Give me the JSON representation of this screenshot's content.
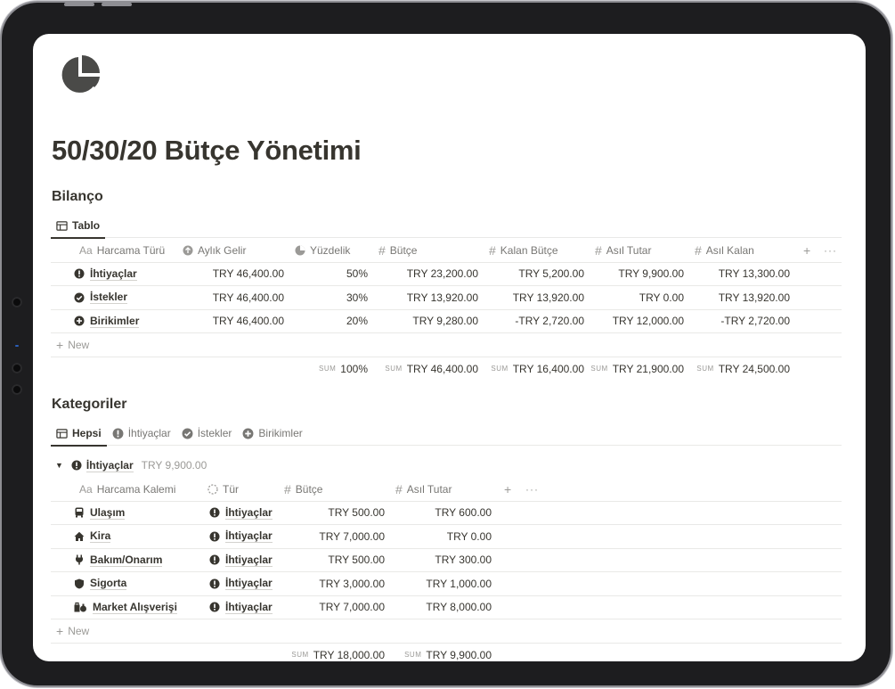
{
  "page": {
    "title": "50/30/20 Bütçe Yönetimi"
  },
  "bilanco": {
    "heading": "Bilanço",
    "view_tab": "Tablo",
    "columns": [
      "Harcama Türü",
      "Aylık Gelir",
      "Yüzdelik",
      "Bütçe",
      "Kalan Bütçe",
      "Asıl Tutar",
      "Asıl Kalan"
    ],
    "rows": [
      {
        "name": "İhtiyaçlar",
        "gelir": "TRY 46,400.00",
        "yuzde": "50%",
        "butce": "TRY 23,200.00",
        "kalan": "TRY 5,200.00",
        "asil": "TRY 9,900.00",
        "asil_kalan": "TRY 13,300.00"
      },
      {
        "name": "İstekler",
        "gelir": "TRY 46,400.00",
        "yuzde": "30%",
        "butce": "TRY 13,920.00",
        "kalan": "TRY 13,920.00",
        "asil": "TRY 0.00",
        "asil_kalan": "TRY 13,920.00"
      },
      {
        "name": "Birikimler",
        "gelir": "TRY 46,400.00",
        "yuzde": "20%",
        "butce": "TRY 9,280.00",
        "kalan": "-TRY 2,720.00",
        "asil": "TRY 12,000.00",
        "asil_kalan": "-TRY 2,720.00"
      }
    ],
    "new_label": "New",
    "sum_label": "SUM",
    "sums": {
      "yuzde": "100%",
      "butce": "TRY 46,400.00",
      "kalan": "TRY 16,400.00",
      "asil": "TRY 21,900.00",
      "asil_kalan": "TRY 24,500.00"
    }
  },
  "kategoriler": {
    "heading": "Kategoriler",
    "tabs": [
      "Hepsi",
      "İhtiyaçlar",
      "İstekler",
      "Birikimler"
    ],
    "group": {
      "name": "İhtiyaçlar",
      "total": "TRY 9,900.00"
    },
    "columns": [
      "Harcama Kalemi",
      "Tür",
      "Bütçe",
      "Asıl Tutar"
    ],
    "rows": [
      {
        "name": "Ulaşım",
        "icon": "bus-icon",
        "tur": "İhtiyaçlar",
        "butce": "TRY 500.00",
        "asil": "TRY 600.00"
      },
      {
        "name": "Kira",
        "icon": "home-icon",
        "tur": "İhtiyaçlar",
        "butce": "TRY 7,000.00",
        "asil": "TRY 0.00"
      },
      {
        "name": "Bakım/Onarım",
        "icon": "plug-icon",
        "tur": "İhtiyaçlar",
        "butce": "TRY 500.00",
        "asil": "TRY 300.00"
      },
      {
        "name": "Sigorta",
        "icon": "shield-icon",
        "tur": "İhtiyaçlar",
        "butce": "TRY 3,000.00",
        "asil": "TRY 1,000.00"
      },
      {
        "name": "Market Alışverişi",
        "icon": "shopping-icon",
        "tur": "İhtiyaçlar",
        "butce": "TRY 7,000.00",
        "asil": "TRY 8,000.00"
      }
    ],
    "new_label": "New",
    "sum_label": "SUM",
    "sums": {
      "butce": "TRY 18,000.00",
      "asil": "TRY 9,900.00"
    }
  },
  "ui": {
    "prop_text_prefix": "Aa",
    "prop_number_prefix": "#",
    "add_prop": "+",
    "more": "···",
    "new_plus": "+",
    "collapse_arrow": "▼"
  }
}
